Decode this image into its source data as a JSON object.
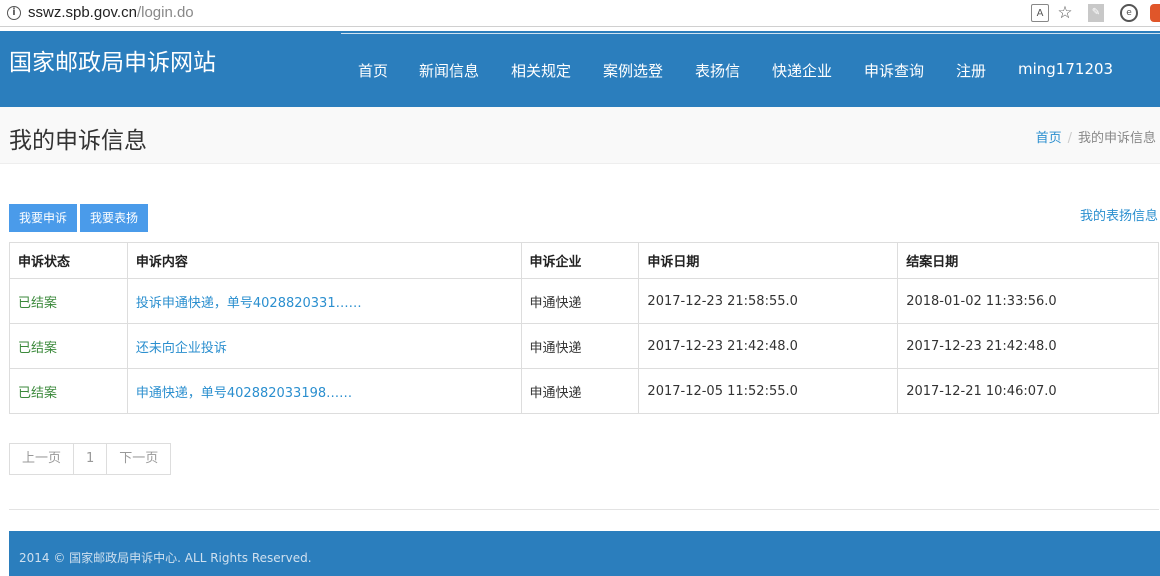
{
  "browser": {
    "url_host": "sswz.spb.gov.cn",
    "url_path": "/login.do",
    "icons": [
      "info-icon",
      "translate-icon",
      "star-icon",
      "pdf-icon",
      "extension-icon",
      "extension-icon-2"
    ]
  },
  "header": {
    "brand": "国家邮政局申诉网站",
    "nav": [
      "首页",
      "新闻信息",
      "相关规定",
      "案例选登",
      "表扬信",
      "快递企业",
      "申诉查询",
      "注册",
      "ming171203"
    ]
  },
  "page": {
    "title": "我的申诉信息",
    "breadcrumb": {
      "home": "首页",
      "current": "我的申诉信息"
    }
  },
  "actions": {
    "complain_label": "我要申诉",
    "praise_label": "我要表扬",
    "praise_info_link": "我的表扬信息"
  },
  "table": {
    "headers": [
      "申诉状态",
      "申诉内容",
      "申诉企业",
      "申诉日期",
      "结案日期"
    ],
    "rows": [
      {
        "status": "已结案",
        "content": "投诉申通快递，单号4028820331……",
        "company": "申通快递",
        "date": "2017-12-23 21:58:55.0",
        "closed": "2018-01-02 11:33:56.0"
      },
      {
        "status": "已结案",
        "content": "还未向企业投诉",
        "company": "申通快递",
        "date": "2017-12-23 21:42:48.0",
        "closed": "2017-12-23 21:42:48.0"
      },
      {
        "status": "已结案",
        "content": "申通快递，单号402882033198……",
        "company": "申通快递",
        "date": "2017-12-05 11:52:55.0",
        "closed": "2017-12-21 10:46:07.0"
      }
    ]
  },
  "pager": {
    "prev": "上一页",
    "page": "1",
    "next": "下一页"
  },
  "footer": {
    "text": "2014 © 国家邮政局申诉中心. ALL Rights Reserved."
  },
  "colors": {
    "header_bg": "#2b7ebd",
    "button_bg": "#4a9bea",
    "link": "#2b8fcf",
    "status_done": "#3c8a3c"
  }
}
